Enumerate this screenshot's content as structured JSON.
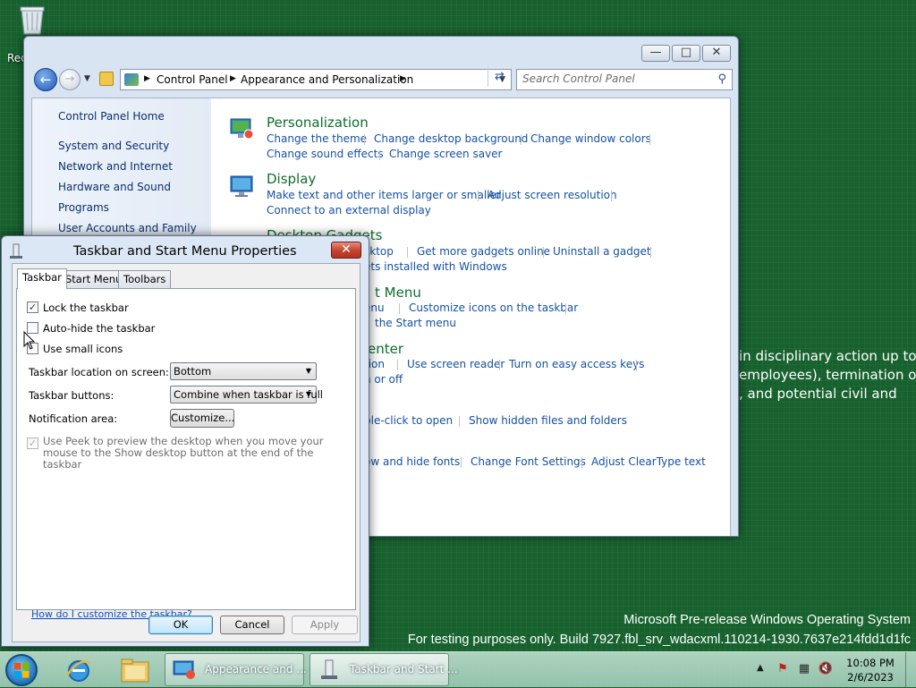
{
  "desktop": {
    "recycle_bin_label": "Rec",
    "background_text": "in disciplinary action up to\nemployees), termination of\n, and potential civil and",
    "watermark_line1": "Microsoft Pre-release Windows Operating System",
    "watermark_line2": "For testing purposes only. Build 7927.fbl_srv_wdacxml.110214-1930.7637e214fdd1d1fc"
  },
  "control_panel": {
    "breadcrumb": [
      "Control Panel",
      "Appearance and Personalization"
    ],
    "search_placeholder": "Search Control Panel",
    "left_nav": {
      "home": "Control Panel Home",
      "items": [
        "System and Security",
        "Network and Internet",
        "Hardware and Sound",
        "Programs",
        "User Accounts and Family"
      ]
    },
    "categories": [
      {
        "title": "Personalization",
        "icon": "personalization-icon",
        "links": [
          "Change the theme",
          "Change desktop background",
          "Change window colors",
          "Change sound effects",
          "Change screen saver"
        ]
      },
      {
        "title": "Display",
        "icon": "display-icon",
        "links": [
          "Make text and other items larger or smaller",
          "Adjust screen resolution",
          "Connect to an external display"
        ]
      },
      {
        "title": "Desktop Gadgets",
        "links": [
          "sktop",
          "Get more gadgets online",
          "Uninstall a gadget",
          "ets installed with Windows"
        ]
      },
      {
        "title": "t Menu",
        "links": [
          "enu",
          "Customize icons on the taskbar",
          "the Start menu"
        ]
      },
      {
        "title": "enter",
        "links": [
          "tion",
          "Use screen reader",
          "Turn on easy access keys",
          "n or off"
        ]
      },
      {
        "links": [
          "ble-click to open",
          "Show hidden files and folders"
        ]
      },
      {
        "links": [
          "ow and hide fonts",
          "Change Font Settings",
          "Adjust ClearType text"
        ]
      }
    ]
  },
  "dialog": {
    "title": "Taskbar and Start Menu Properties",
    "tabs": [
      "Taskbar",
      "Start Menu",
      "Toolbars"
    ],
    "checkboxes": [
      {
        "label": "Lock the taskbar",
        "checked": true
      },
      {
        "label": "Auto-hide the taskbar",
        "checked": false
      },
      {
        "label": "Use small icons",
        "checked": false
      }
    ],
    "location_label": "Taskbar location on screen:",
    "location_value": "Bottom",
    "buttons_label": "Taskbar buttons:",
    "buttons_value": "Combine when taskbar is full",
    "notification_label": "Notification area:",
    "customize_button": "Customize...",
    "peek_label": "Use Peek to preview the desktop when you move your mouse to the Show desktop button at the end of the taskbar",
    "help_link": "How do I customize the taskbar?",
    "ok": "OK",
    "cancel": "Cancel",
    "apply": "Apply"
  },
  "taskbar": {
    "tasks": [
      "Appearance and ...",
      "Taskbar and Start ..."
    ],
    "clock_time": "10:08 PM",
    "clock_date": "2/6/2023"
  }
}
